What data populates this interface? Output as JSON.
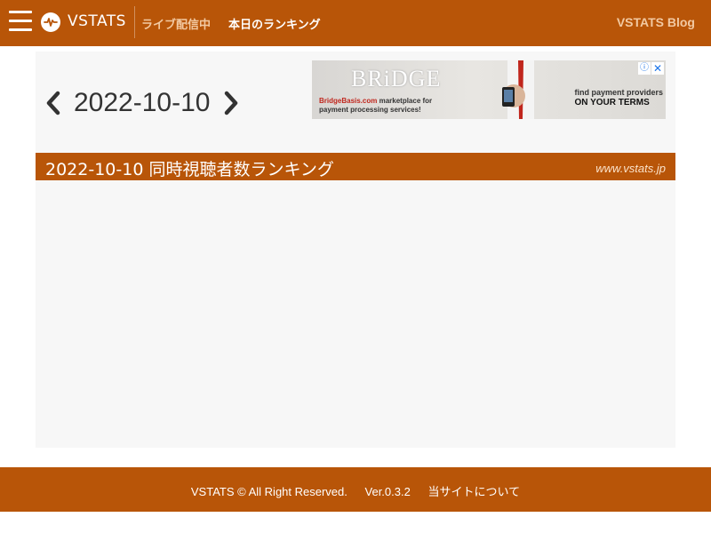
{
  "header": {
    "logo_text": "VSTATS",
    "nav_live": "ライブ配信中",
    "nav_ranking": "本日のランキング",
    "nav_blog": "VSTATS Blog",
    "colors": {
      "primary": "#b85508",
      "nav_muted": "#f2c9a2"
    }
  },
  "date_nav": {
    "date": "2022-10-10",
    "prev_icon": "chevron-left-icon",
    "next_icon": "chevron-right-icon"
  },
  "ad": {
    "brand": "BRiDGE",
    "caption_site": "BridgeBasis.com",
    "caption_line1": " marketplace for",
    "caption_line2": "payment processing services!",
    "find_line1": "find payment providers",
    "find_line2": "ON YOUR TERMS",
    "info_icon": "info-icon",
    "close_icon": "close-icon"
  },
  "ranking": {
    "title": "2022-10-10 同時視聴者数ランキング",
    "site": "www.vstats.jp"
  },
  "footer": {
    "copyright": "VSTATS © All Right Reserved.",
    "version": "Ver.0.3.2",
    "about": "当サイトについて"
  }
}
